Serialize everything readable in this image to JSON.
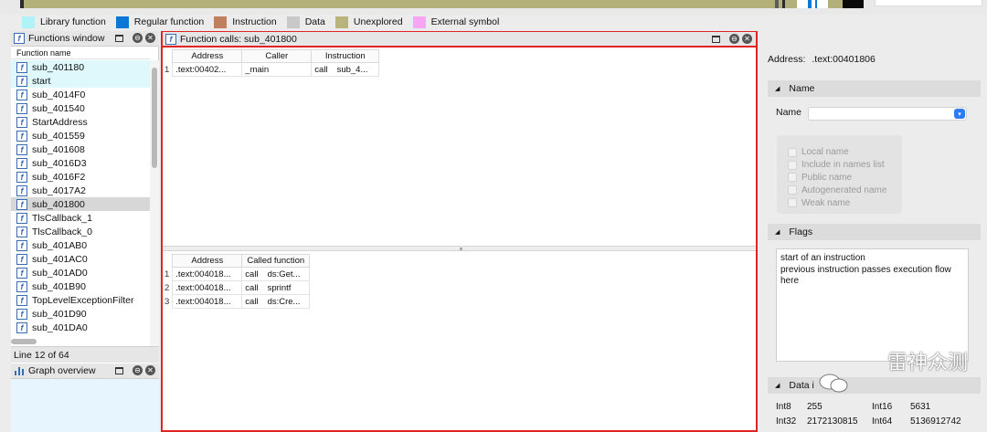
{
  "colors": {
    "library_function": "#aef3f7",
    "regular_function": "#0b78d7",
    "instruction": "#c08060",
    "data": "#c8c8c8",
    "unexplored": "#b8b47c",
    "external_symbol": "#f6a6f2",
    "highlight_border": "#e02424"
  },
  "legend": [
    {
      "label": "Library function",
      "color": "#aef3f7"
    },
    {
      "label": "Regular function",
      "color": "#0b78d7"
    },
    {
      "label": "Instruction",
      "color": "#c08060"
    },
    {
      "label": "Data",
      "color": "#c8c8c8"
    },
    {
      "label": "Unexplored",
      "color": "#b8b47c"
    },
    {
      "label": "External symbol",
      "color": "#f6a6f2"
    }
  ],
  "functions_window": {
    "title": "Functions window",
    "icon": "function-icon",
    "column_header": "Function name",
    "items": [
      {
        "name": "sub_401180",
        "state": "library"
      },
      {
        "name": "start",
        "state": "library"
      },
      {
        "name": "sub_4014F0",
        "state": ""
      },
      {
        "name": "sub_401540",
        "state": ""
      },
      {
        "name": "StartAddress",
        "state": ""
      },
      {
        "name": "sub_401559",
        "state": ""
      },
      {
        "name": "sub_401608",
        "state": ""
      },
      {
        "name": "sub_4016D3",
        "state": ""
      },
      {
        "name": "sub_4016F2",
        "state": ""
      },
      {
        "name": "sub_4017A2",
        "state": ""
      },
      {
        "name": "sub_401800",
        "state": "selected"
      },
      {
        "name": "TlsCallback_1",
        "state": ""
      },
      {
        "name": "TlsCallback_0",
        "state": ""
      },
      {
        "name": "sub_401AB0",
        "state": ""
      },
      {
        "name": "sub_401AC0",
        "state": ""
      },
      {
        "name": "sub_401AD0",
        "state": ""
      },
      {
        "name": "sub_401B90",
        "state": ""
      },
      {
        "name": "TopLevelExceptionFilter",
        "state": ""
      },
      {
        "name": "sub_401D90",
        "state": ""
      },
      {
        "name": "sub_401DA0",
        "state": ""
      }
    ],
    "status": "Line 12 of 64"
  },
  "graph_overview": {
    "title": "Graph overview",
    "icon": "graph-icon"
  },
  "function_calls": {
    "title": "Function calls: sub_401800",
    "callers": {
      "headers": [
        "Address",
        "Caller",
        "Instruction"
      ],
      "rows": [
        {
          "idx": "1",
          "address": ".text:00402...",
          "caller": "_main",
          "op": "call",
          "target": "sub_4..."
        }
      ]
    },
    "callees": {
      "headers": [
        "Address",
        "Called function"
      ],
      "rows": [
        {
          "idx": "1",
          "address": ".text:004018...",
          "op": "call",
          "target": "ds:Get..."
        },
        {
          "idx": "2",
          "address": ".text:004018...",
          "op": "call",
          "target": "sprintf"
        },
        {
          "idx": "3",
          "address": ".text:004018...",
          "op": "call",
          "target": "ds:Cre..."
        }
      ]
    }
  },
  "info_panel": {
    "address_label": "Address:",
    "address_value": ".text:00401806",
    "name_section": "Name",
    "name_label": "Name",
    "name_value": "",
    "checkboxes": [
      "Local name",
      "Include in names list",
      "Public name",
      "Autogenerated name",
      "Weak name"
    ],
    "flags_section": "Flags",
    "flags_text_line1": "start of an instruction",
    "flags_text_line2": "previous instruction passes execution flow",
    "flags_text_line3": "here",
    "data_section": "Data i",
    "int8_label": "Int8",
    "int8_value": "255",
    "int16_label": "Int16",
    "int16_value": "5631",
    "int32_label": "Int32",
    "int32_value": "2172130815",
    "int64_label": "Int64",
    "int64_value": "5136912742"
  },
  "watermark": "雷神众测"
}
